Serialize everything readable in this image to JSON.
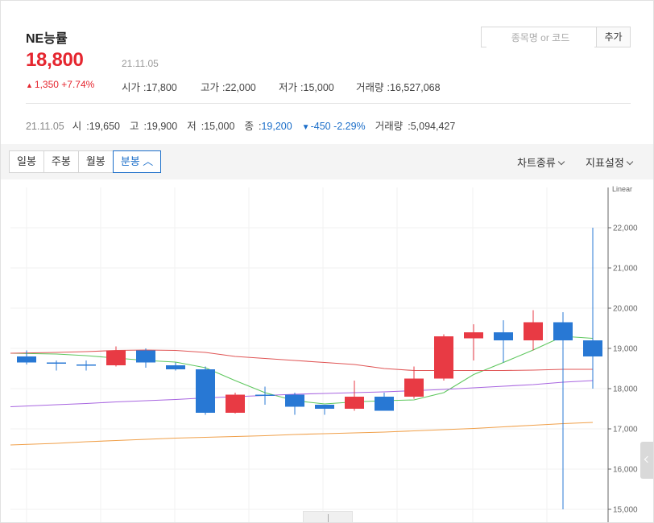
{
  "stock": {
    "name": "NE능률",
    "price": "18,800",
    "date": "21.11.05",
    "change": "1,350 +7.74%",
    "change_arrow": "▲",
    "open_label": "시가",
    "open": "17,800",
    "high_label": "고가",
    "high": "22,000",
    "low_label": "저가",
    "low": "15,000",
    "volume_label": "거래량",
    "volume": "16,527,068"
  },
  "search": {
    "placeholder": "종목명 or 코드",
    "add_label": "추가"
  },
  "prev_day": {
    "date": "21.11.05",
    "open_label": "시",
    "open": "19,650",
    "high_label": "고",
    "high": "19,900",
    "low_label": "저",
    "low": "15,000",
    "close_label": "종",
    "close": "19,200",
    "change_arrow": "▼",
    "change": "-450 -2.29%",
    "volume_label": "거래량",
    "volume": "5,094,427"
  },
  "toolbar": {
    "tabs": [
      {
        "label": "일봉",
        "active": false
      },
      {
        "label": "주봉",
        "active": false
      },
      {
        "label": "월봉",
        "active": false
      },
      {
        "label": "분봉 ︿",
        "active": true
      }
    ],
    "chart_type_label": "차트종류",
    "indicator_label": "지표설정"
  },
  "colors": {
    "up": "#e83a44",
    "down": "#2878d4",
    "ma5": "#5ec75e",
    "ma20": "#e05555",
    "ma60": "#a866e0",
    "ma120": "#f0a04a",
    "accent": "#1b6ec9"
  },
  "chart_data": {
    "type": "candlestick",
    "scale_label": "Linear",
    "ylim": [
      15000,
      22000
    ],
    "y_ticks": [
      "15,000",
      "16,000",
      "17,000",
      "18,000",
      "19,000",
      "20,000",
      "21,000",
      "22,000"
    ],
    "y_tick_values": [
      15000,
      16000,
      17000,
      18000,
      19000,
      20000,
      21000,
      22000
    ],
    "grid": true,
    "candles": [
      {
        "o": 18800,
        "h": 18950,
        "l": 18600,
        "c": 18650
      },
      {
        "o": 18650,
        "h": 18700,
        "l": 18450,
        "c": 18620
      },
      {
        "o": 18600,
        "h": 18700,
        "l": 18450,
        "c": 18580
      },
      {
        "o": 18580,
        "h": 19050,
        "l": 18550,
        "c": 18950
      },
      {
        "o": 18950,
        "h": 19000,
        "l": 18520,
        "c": 18650
      },
      {
        "o": 18580,
        "h": 18650,
        "l": 18450,
        "c": 18480
      },
      {
        "o": 18480,
        "h": 18550,
        "l": 17350,
        "c": 17400
      },
      {
        "o": 17400,
        "h": 17900,
        "l": 17380,
        "c": 17850
      },
      {
        "o": 17850,
        "h": 18050,
        "l": 17600,
        "c": 17830
      },
      {
        "o": 17850,
        "h": 17900,
        "l": 17350,
        "c": 17550
      },
      {
        "o": 17600,
        "h": 17600,
        "l": 17350,
        "c": 17500
      },
      {
        "o": 17500,
        "h": 18200,
        "l": 17450,
        "c": 17800
      },
      {
        "o": 17800,
        "h": 17900,
        "l": 17450,
        "c": 17450
      },
      {
        "o": 17800,
        "h": 18550,
        "l": 17750,
        "c": 18250
      },
      {
        "o": 18250,
        "h": 19350,
        "l": 18200,
        "c": 19300
      },
      {
        "o": 19250,
        "h": 19600,
        "l": 18700,
        "c": 19400
      },
      {
        "o": 19400,
        "h": 19700,
        "l": 18650,
        "c": 19200
      },
      {
        "o": 19200,
        "h": 19950,
        "l": 18950,
        "c": 19650
      },
      {
        "o": 19650,
        "h": 19900,
        "l": 15000,
        "c": 19200
      },
      {
        "o": 19200,
        "h": 22000,
        "l": 18000,
        "c": 18800
      }
    ],
    "moving_averages": [
      {
        "name": "MA5",
        "values": [
          18880,
          18860,
          18820,
          18760,
          18700,
          18660,
          18520,
          18200,
          17900,
          17700,
          17620,
          17670,
          17700,
          17720,
          17900,
          18350,
          18650,
          18960,
          19300,
          19250
        ]
      },
      {
        "name": "MA20",
        "values": [
          18880,
          18900,
          18920,
          18950,
          18960,
          18950,
          18900,
          18800,
          18750,
          18700,
          18650,
          18600,
          18500,
          18450,
          18450,
          18450,
          18450,
          18460,
          18480,
          18480
        ]
      },
      {
        "name": "MA60",
        "values": [
          17550,
          17600,
          17630,
          17670,
          17700,
          17730,
          17770,
          17800,
          17830,
          17860,
          17880,
          17900,
          17920,
          17950,
          17980,
          18020,
          18060,
          18100,
          18160,
          18200
        ]
      },
      {
        "name": "MA120",
        "values": [
          16600,
          16640,
          16680,
          16710,
          16740,
          16770,
          16790,
          16810,
          16830,
          16860,
          16880,
          16900,
          16920,
          16950,
          16980,
          17010,
          17050,
          17090,
          17130,
          17160
        ]
      }
    ]
  }
}
